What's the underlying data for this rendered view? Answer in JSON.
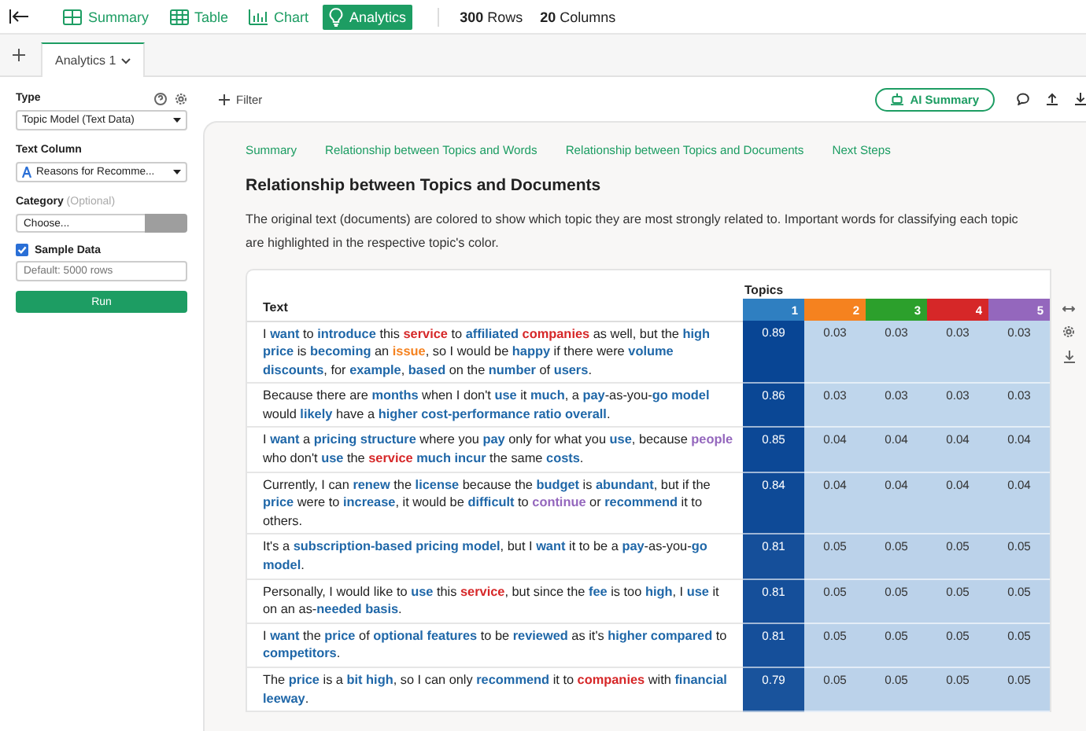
{
  "toolbar": {
    "views": [
      {
        "label": "Summary",
        "selected": false,
        "kind": "summary"
      },
      {
        "label": "Table",
        "selected": false,
        "kind": "table"
      },
      {
        "label": "Chart",
        "selected": false,
        "kind": "chart"
      },
      {
        "label": "Analytics",
        "selected": true,
        "kind": "analytics"
      }
    ],
    "rows_count": "**300** Rows",
    "columns_count": "**20** Columns"
  },
  "tabs": [
    {
      "label": "Analytics 1",
      "selected": true
    }
  ],
  "sidebar": {
    "type_label": "Type",
    "type_value": "Topic Model (Text Data)",
    "text_column_label": "Text Column",
    "text_column_value": "Reasons for Recomme...",
    "category_label": "Category",
    "category_hint": "(Optional)",
    "category_placeholder": "Choose...",
    "sample_label": "Sample Data",
    "sample_checked": true,
    "sample_placeholder": "Default: 5000 rows",
    "run": "Run"
  },
  "main": {
    "filter": "Filter",
    "ai_summary": "AI Summary",
    "nav": [
      "Summary",
      "Relationship between Topics and Words",
      "Relationship between Topics and Documents",
      "Next Steps"
    ],
    "heading": "Relationship between Topics and Documents",
    "description": "The original text (documents) are colored to show which topic they are most strongly related to. Important words for classifying each topic are highlighted in the respective topic's color.",
    "table": {
      "text_header": "Text",
      "topics_header": "Topics",
      "topics": [
        {
          "label": "1",
          "color": "#2f7fc1"
        },
        {
          "label": "2",
          "color": "#f5821f"
        },
        {
          "label": "3",
          "color": "#2ca02c"
        },
        {
          "label": "4",
          "color": "#d62728"
        },
        {
          "label": "5",
          "color": "#9467bd"
        }
      ],
      "rows": [
        {
          "text": [
            {
              "text": "I "
            },
            {
              "text": "want",
              "color": "#1f67a8"
            },
            {
              "text": " to "
            },
            {
              "text": "introduce",
              "color": "#1f67a8"
            },
            {
              "text": " this "
            },
            {
              "text": "service",
              "color": "#d62728"
            },
            {
              "text": " to "
            },
            {
              "text": "affiliated ",
              "color": "#1f67a8"
            },
            {
              "text": "companies",
              "color": "#d62728"
            },
            {
              "text": " as well, but the "
            },
            {
              "text": "high price",
              "color": "#1f67a8"
            },
            {
              "text": " is "
            },
            {
              "text": "becoming",
              "color": "#1f67a8"
            },
            {
              "text": " an "
            },
            {
              "text": "issue",
              "color": "#f5821f"
            },
            {
              "text": ", so I would be "
            },
            {
              "text": "happy",
              "color": "#1f67a8"
            },
            {
              "text": " if there were "
            },
            {
              "text": "volume discounts",
              "color": "#1f67a8"
            },
            {
              "text": ", for "
            },
            {
              "text": "example",
              "color": "#1f67a8"
            },
            {
              "text": ", "
            },
            {
              "text": "based",
              "color": "#1f67a8"
            },
            {
              "text": " on the "
            },
            {
              "text": "number",
              "color": "#1f67a8"
            },
            {
              "text": " of "
            },
            {
              "text": "users",
              "color": "#1f67a8"
            },
            {
              "text": "."
            }
          ],
          "values": [
            "0.89",
            "0.03",
            "0.03",
            "0.03",
            "0.03"
          ]
        },
        {
          "text": [
            {
              "text": "Because there are "
            },
            {
              "text": "months",
              "color": "#1f67a8"
            },
            {
              "text": " when I don't "
            },
            {
              "text": "use",
              "color": "#1f67a8"
            },
            {
              "text": " it "
            },
            {
              "text": "much",
              "color": "#1f67a8"
            },
            {
              "text": ", a "
            },
            {
              "text": "pay",
              "color": "#1f67a8"
            },
            {
              "text": "-as-you-"
            },
            {
              "text": "go model",
              "color": "#1f67a8"
            },
            {
              "text": " would "
            },
            {
              "text": "likely",
              "color": "#1f67a8"
            },
            {
              "text": " have a "
            },
            {
              "text": "higher cost-performance ratio overall",
              "color": "#1f67a8"
            },
            {
              "text": "."
            }
          ],
          "values": [
            "0.86",
            "0.03",
            "0.03",
            "0.03",
            "0.03"
          ]
        },
        {
          "text": [
            {
              "text": "I "
            },
            {
              "text": "want",
              "color": "#1f67a8"
            },
            {
              "text": " a "
            },
            {
              "text": "pricing structure",
              "color": "#1f67a8"
            },
            {
              "text": " where you "
            },
            {
              "text": "pay",
              "color": "#1f67a8"
            },
            {
              "text": " only for what you "
            },
            {
              "text": "use",
              "color": "#1f67a8"
            },
            {
              "text": ", because "
            },
            {
              "text": "people",
              "color": "#9467bd"
            },
            {
              "text": " who don't "
            },
            {
              "text": "use",
              "color": "#1f67a8"
            },
            {
              "text": " the "
            },
            {
              "text": "service ",
              "color": "#d62728"
            },
            {
              "text": "much incur",
              "color": "#1f67a8"
            },
            {
              "text": " the same "
            },
            {
              "text": "costs",
              "color": "#1f67a8"
            },
            {
              "text": "."
            }
          ],
          "values": [
            "0.85",
            "0.04",
            "0.04",
            "0.04",
            "0.04"
          ]
        },
        {
          "text": [
            {
              "text": "Currently, I can "
            },
            {
              "text": "renew",
              "color": "#1f67a8"
            },
            {
              "text": " the "
            },
            {
              "text": "license",
              "color": "#1f67a8"
            },
            {
              "text": " because the "
            },
            {
              "text": "budget",
              "color": "#1f67a8"
            },
            {
              "text": " is "
            },
            {
              "text": "abundant",
              "color": "#1f67a8"
            },
            {
              "text": ", but if the "
            },
            {
              "text": "price",
              "color": "#1f67a8"
            },
            {
              "text": " were to "
            },
            {
              "text": "increase",
              "color": "#1f67a8"
            },
            {
              "text": ", it would be "
            },
            {
              "text": "difficult",
              "color": "#1f67a8"
            },
            {
              "text": " to "
            },
            {
              "text": "continue",
              "color": "#9467bd"
            },
            {
              "text": " or "
            },
            {
              "text": "recommend",
              "color": "#1f67a8"
            },
            {
              "text": " it to others."
            }
          ],
          "values": [
            "0.84",
            "0.04",
            "0.04",
            "0.04",
            "0.04"
          ]
        },
        {
          "text": [
            {
              "text": "It's a "
            },
            {
              "text": "subscription-based pricing model",
              "color": "#1f67a8"
            },
            {
              "text": ", but I "
            },
            {
              "text": "want",
              "color": "#1f67a8"
            },
            {
              "text": " it to be a "
            },
            {
              "text": "pay",
              "color": "#1f67a8"
            },
            {
              "text": "-as-you-"
            },
            {
              "text": "go model",
              "color": "#1f67a8"
            },
            {
              "text": "."
            }
          ],
          "values": [
            "0.81",
            "0.05",
            "0.05",
            "0.05",
            "0.05"
          ]
        },
        {
          "text": [
            {
              "text": "Personally, I would like to "
            },
            {
              "text": "use",
              "color": "#1f67a8"
            },
            {
              "text": " this "
            },
            {
              "text": "service",
              "color": "#d62728"
            },
            {
              "text": ", but since the "
            },
            {
              "text": "fee",
              "color": "#1f67a8"
            },
            {
              "text": " is too "
            },
            {
              "text": "high",
              "color": "#1f67a8"
            },
            {
              "text": ", I "
            },
            {
              "text": "use",
              "color": "#1f67a8"
            },
            {
              "text": " it on an as-"
            },
            {
              "text": "needed basis",
              "color": "#1f67a8"
            },
            {
              "text": "."
            }
          ],
          "values": [
            "0.81",
            "0.05",
            "0.05",
            "0.05",
            "0.05"
          ]
        },
        {
          "text": [
            {
              "text": "I "
            },
            {
              "text": "want",
              "color": "#1f67a8"
            },
            {
              "text": " the "
            },
            {
              "text": "price",
              "color": "#1f67a8"
            },
            {
              "text": " of "
            },
            {
              "text": "optional features",
              "color": "#1f67a8"
            },
            {
              "text": " to be "
            },
            {
              "text": "reviewed",
              "color": "#1f67a8"
            },
            {
              "text": " as it's "
            },
            {
              "text": "higher compared",
              "color": "#1f67a8"
            },
            {
              "text": " to "
            },
            {
              "text": "competitors",
              "color": "#1f67a8"
            },
            {
              "text": "."
            }
          ],
          "values": [
            "0.81",
            "0.05",
            "0.05",
            "0.05",
            "0.05"
          ]
        },
        {
          "text": [
            {
              "text": "The "
            },
            {
              "text": "price",
              "color": "#1f67a8"
            },
            {
              "text": " is a "
            },
            {
              "text": "bit high",
              "color": "#1f67a8"
            },
            {
              "text": ", so I can only "
            },
            {
              "text": "recommend",
              "color": "#1f67a8"
            },
            {
              "text": " it to "
            },
            {
              "text": "companies",
              "color": "#d62728"
            },
            {
              "text": " with "
            },
            {
              "text": "financial leeway",
              "color": "#1f67a8"
            },
            {
              "text": "."
            }
          ],
          "values": [
            "0.79",
            "0.05",
            "0.05",
            "0.05",
            "0.05"
          ]
        }
      ]
    }
  }
}
